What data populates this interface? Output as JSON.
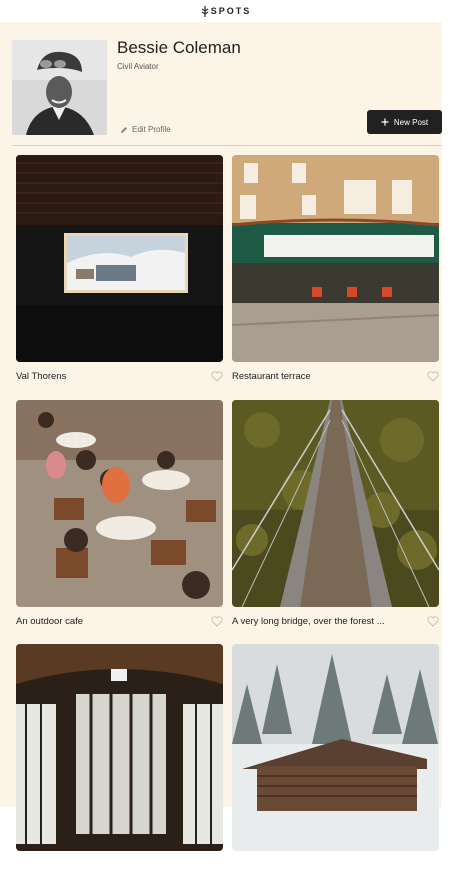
{
  "header": {
    "logo_text": "SPOTS"
  },
  "profile": {
    "name": "Bessie Coleman",
    "description": "Civil Aviator",
    "edit_label": "Edit Profile",
    "new_post_label": "New Post"
  },
  "cards": [
    {
      "title": "Val Thorens"
    },
    {
      "title": "Restaurant terrace"
    },
    {
      "title": "An outdoor cafe"
    },
    {
      "title": "A very long bridge, over the forest ..."
    },
    {
      "title": ""
    },
    {
      "title": ""
    }
  ],
  "colors": {
    "background": "#fcf4e6",
    "text": "#212121",
    "button": "#212121"
  }
}
